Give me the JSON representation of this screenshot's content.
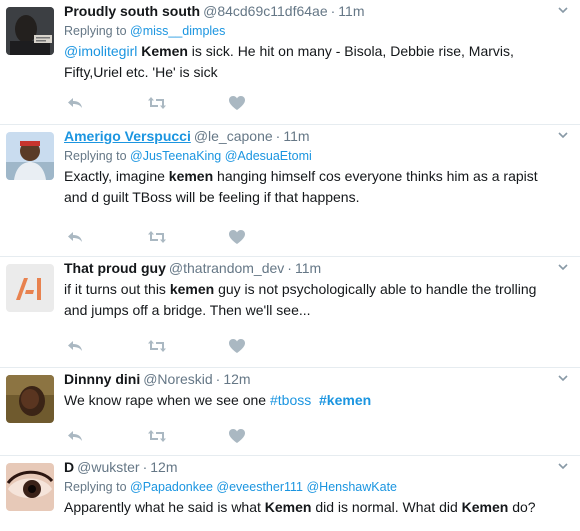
{
  "colors": {
    "accent": "#1b95e0",
    "muted": "#657786",
    "text": "#14171a",
    "divider": "#e6ecf0",
    "icon": "#aab8c2"
  },
  "tweets": [
    {
      "name": "Proudly south south",
      "handle": "@84cd69c11df64ae",
      "time": "11m",
      "replying": {
        "prefix": "Replying to ",
        "targets": [
          "@miss__dimples"
        ]
      },
      "avatar": "portrait-icon",
      "segments": [
        {
          "t": "@imolitegirl",
          "s": "mention"
        },
        {
          "t": " ",
          "s": ""
        },
        {
          "t": "Kemen",
          "s": "kw"
        },
        {
          "t": " is sick. He hit on many - Bisola, Debbie rise, Marvis, Fifty,Uriel etc. 'He' is sick",
          "s": ""
        }
      ]
    },
    {
      "name": "Amerigo Verspucci",
      "handle": "@le_capone",
      "time": "11m",
      "replying": {
        "prefix": "Replying to ",
        "targets": [
          "@JusTeenaKing",
          "@AdesuaEtomi"
        ]
      },
      "avatar": "person-icon",
      "segments": [
        {
          "t": "Exactly, imagine ",
          "s": ""
        },
        {
          "t": "kemen",
          "s": "kw"
        },
        {
          "t": " hanging himself cos everyone thinks him as a rapist and d guilt TBoss will be feeling if that happens.",
          "s": ""
        }
      ]
    },
    {
      "name": "That proud guy",
      "handle": "@thatrandom_dev",
      "time": "11m",
      "replying": null,
      "avatar": "logo-icon",
      "segments": [
        {
          "t": "if it turns out this ",
          "s": ""
        },
        {
          "t": "kemen",
          "s": "kw"
        },
        {
          "t": " guy is not psychologically able to handle the trolling and jumps off a bridge. Then we'll see...",
          "s": ""
        }
      ]
    },
    {
      "name": "Dinnny dini",
      "handle": "@Noreskid",
      "time": "12m",
      "replying": null,
      "avatar": "person-icon",
      "segments": [
        {
          "t": "We know rape when we see one ",
          "s": ""
        },
        {
          "t": "#tboss",
          "s": "hashtag"
        },
        {
          "t": "  ",
          "s": ""
        },
        {
          "t": "#kemen",
          "s": "kw hashtag"
        }
      ]
    },
    {
      "name": "D",
      "handle": "@wukster",
      "time": "12m",
      "replying": {
        "prefix": "Replying to ",
        "targets": [
          "@Papadonkee",
          "@eveesther111",
          "@HenshawKate"
        ]
      },
      "avatar": "eye-icon",
      "segments": [
        {
          "t": "Apparently what he said is what ",
          "s": ""
        },
        {
          "t": "Kemen",
          "s": "kw"
        },
        {
          "t": " did is normal. What did ",
          "s": ""
        },
        {
          "t": "Kemen",
          "s": "kw"
        },
        {
          "t": " do?",
          "s": ""
        }
      ]
    }
  ],
  "action_icons": [
    "reply-icon",
    "retweet-icon",
    "like-icon"
  ]
}
